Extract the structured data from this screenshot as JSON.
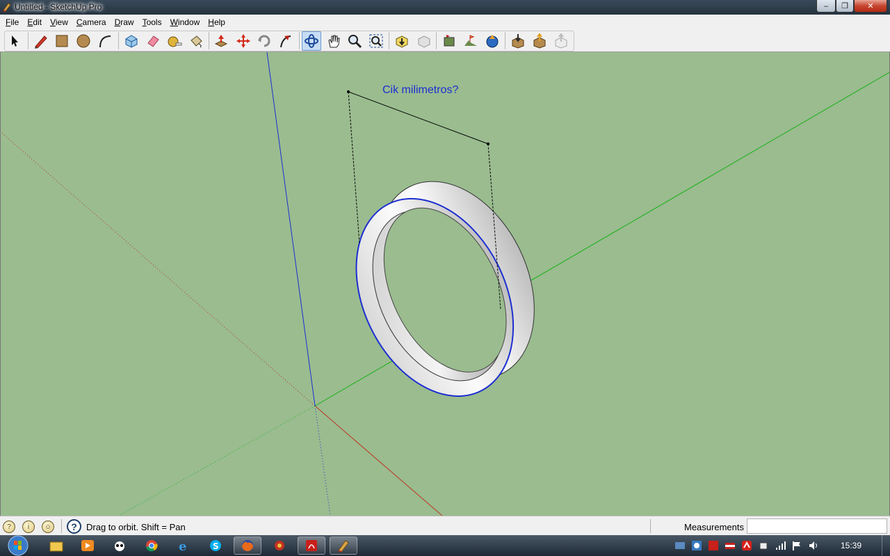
{
  "window": {
    "title": "Untitled - SketchUp Pro",
    "controls": {
      "minimize": "–",
      "maximize": "❐",
      "close": "✕"
    }
  },
  "menu": [
    {
      "label": "File"
    },
    {
      "label": "Edit"
    },
    {
      "label": "View"
    },
    {
      "label": "Camera"
    },
    {
      "label": "Draw"
    },
    {
      "label": "Tools"
    },
    {
      "label": "Window"
    },
    {
      "label": "Help"
    }
  ],
  "toolbar": {
    "tools": [
      "select-icon",
      "pencil-icon",
      "rectangle-icon",
      "circle-icon",
      "arc-icon",
      "make-component-icon",
      "eraser-icon",
      "tape-measure-icon",
      "paint-bucket-icon",
      "push-pull-icon",
      "move-icon",
      "rotate-icon",
      "follow-me-icon",
      "orbit-icon",
      "pan-icon",
      "zoom-icon",
      "zoom-extents-icon",
      "previous-view-icon",
      "next-view-icon",
      "add-location-icon",
      "toggle-terrain-icon",
      "google-earth-icon",
      "get-models-icon",
      "share-model-icon",
      "share-component-icon"
    ],
    "active_tool": "orbit-icon"
  },
  "viewport": {
    "dimension_text": "Cik milimetros?",
    "colors": {
      "background": "#9abc8f",
      "x_axis": "#c0301f",
      "y_axis": "#17b017",
      "z_axis": "#1c2ed1"
    }
  },
  "status": {
    "message": "Drag to orbit.  Shift = Pan",
    "measurements_label": "Measurements",
    "measurements_value": "",
    "help_glyph": "?"
  },
  "taskbar": {
    "clock": "15:39",
    "apps": [
      "windows-explorer-icon",
      "media-player-icon",
      "panda-icon",
      "chrome-icon",
      "internet-explorer-icon",
      "skype-icon",
      "firefox-icon",
      "app-icon",
      "acrobat-icon",
      "sketchup-icon"
    ]
  }
}
